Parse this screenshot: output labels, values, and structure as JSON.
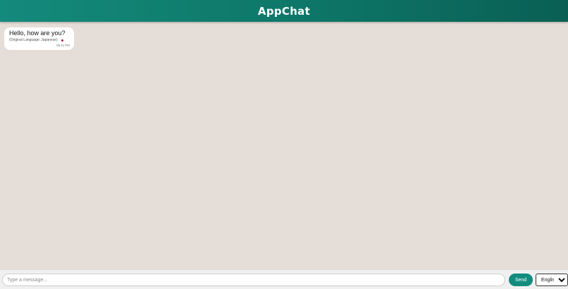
{
  "header": {
    "title": "AppChat",
    "color": "#128c7e"
  },
  "messages": [
    {
      "text": "Hello, how are you?",
      "original_language_label": "(Original Language: Japanese)",
      "time": "06:11 PM",
      "status_dot_color": "#b3163a"
    }
  ],
  "composer": {
    "placeholder": "Type a message...",
    "value": "",
    "send_label": "Send",
    "language_selected": "English",
    "language_options": [
      "English"
    ]
  }
}
